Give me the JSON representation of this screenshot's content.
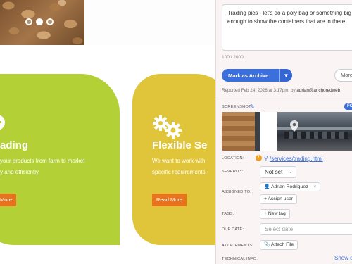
{
  "site": {
    "card1": {
      "title": "ading",
      "line1": "your products from farm to market",
      "line2": "y and efficiently.",
      "button": "More"
    },
    "card2": {
      "title": "Flexible Se",
      "line1": "We want to work with",
      "line2": "specific requirements.",
      "button": "Read More"
    },
    "colors": {
      "card1": "#b3d136",
      "card2": "#e0c53a",
      "button": "#e8731c"
    }
  },
  "panel": {
    "description": "Trading pics - let's do a poly bag or something big enough to show the containers that are in there.",
    "char_count": "100 / 2000",
    "archive_button": "Mark as Archive",
    "archive_menu_icon": "chevron-down-icon",
    "more_button": "More",
    "reported_prefix": "Reported Feb 24, 2026 at 3:17pm, by",
    "reporter": "adrian@anchoredweb",
    "screenshot_label": "SCREENSHOT",
    "screenshot_badge": "FO",
    "location_label": "LOCATION:",
    "location_link": "/services/trading.html",
    "severity_label": "SEVERITY:",
    "severity_value": "Not set",
    "assigned_label": "ASSIGNED TO:",
    "assignee": "Adrian Rodriguez",
    "assign_button": "Assign user",
    "tags_label": "TAGS:",
    "new_tag_button": "New tag",
    "due_label": "DUE DATE:",
    "due_placeholder": "Select date",
    "attachments_label": "ATTACHMENTS:",
    "attach_button": "Attach File",
    "technical_label": "TECHNICAL INFO:",
    "show_details": "Show d",
    "accent": "#3b6fdc"
  }
}
